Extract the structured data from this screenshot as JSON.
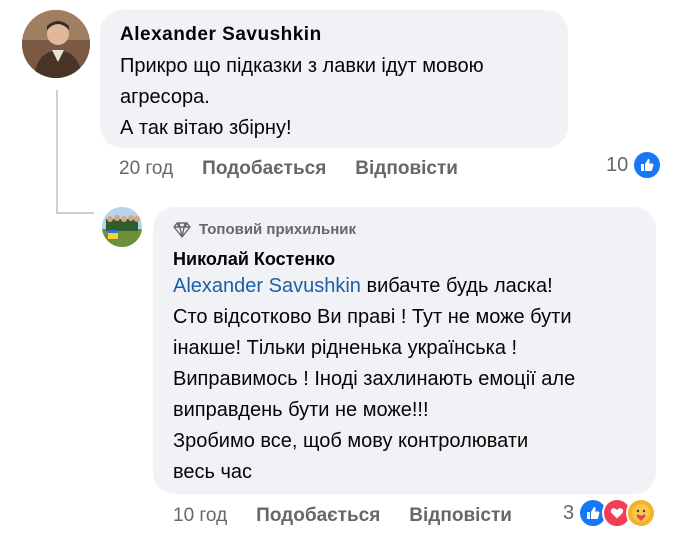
{
  "comments": [
    {
      "author": "Alexander  Savushkin",
      "text_lines": [
        "Прикро що підказки з лавки ідут мовою",
        "агресора.",
        "А так вітаю збірну!"
      ],
      "time": "20 год",
      "like_label": "Подобається",
      "reply_label": "Відповісти",
      "reaction_count": "10",
      "reactions": [
        "like-icon"
      ]
    },
    {
      "badge": "Топовий прихильник",
      "badge_icon": "diamond-icon",
      "author": "Николай Костенко",
      "mention": "Alexander  Savushkin",
      "text_first_rest": " вибачте будь ласка!",
      "text_lines": [
        "Сто відсотково Ви праві ! Тут не може бути",
        "інакше! Тільки рідненька українська !",
        "Виправимось ! Іноді захлинають емоції але",
        "виправдень бути не може!!!",
        "Зробимо все, щоб мову контролювати",
        "весь час"
      ],
      "time": "10 год",
      "like_label": "Подобається",
      "reply_label": "Відповісти",
      "reaction_count": "3",
      "reactions": [
        "like-icon",
        "love-icon",
        "care-icon"
      ]
    }
  ],
  "colors": {
    "bubble": "#f0f2f5",
    "mention": "#1d5ea8",
    "secondary_text": "#65676b",
    "like_blue": "#1877f2",
    "love_red": "#f33e58",
    "care_yellow": "#f7b125"
  }
}
